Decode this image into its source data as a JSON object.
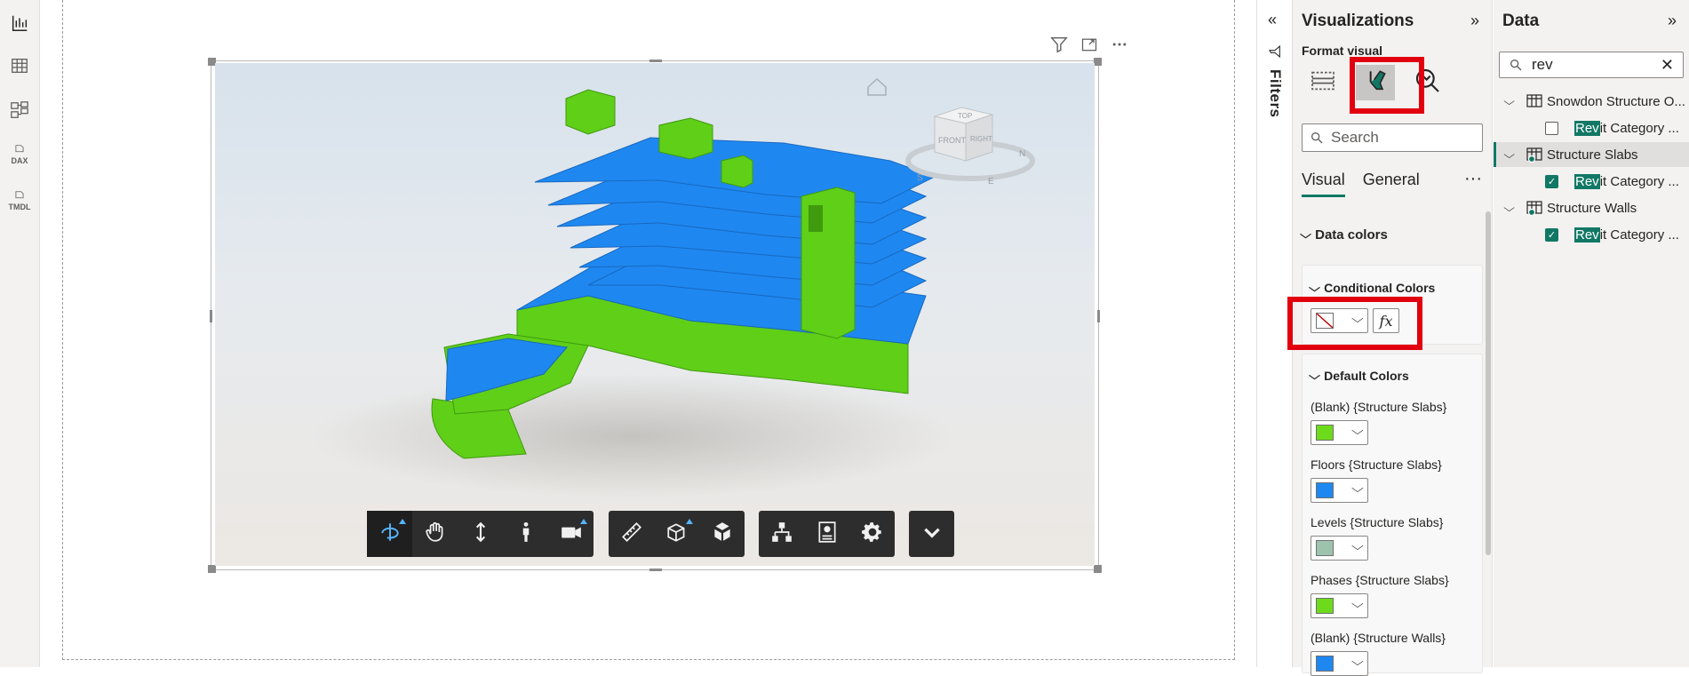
{
  "canvas": {
    "toolbar_groups": [
      [
        "orbit-icon",
        "pan-icon",
        "zoom-icon",
        "walk-icon",
        "camera-icon"
      ],
      [
        "measure-icon",
        "section-icon",
        "explode-icon"
      ],
      [
        "model-browser-icon",
        "properties-icon",
        "settings-icon"
      ],
      [
        "expand-chevron-icon"
      ]
    ]
  },
  "filters": {
    "label": "Filters"
  },
  "visualizations": {
    "title": "Visualizations",
    "format_visual_label": "Format visual",
    "search_placeholder": "Search",
    "tabs": {
      "visual": "Visual",
      "general": "General"
    },
    "sections": {
      "data_colors": "Data colors",
      "conditional_colors": "Conditional Colors",
      "default_colors": "Default Colors"
    },
    "fx_label": "fx",
    "color_rows": [
      {
        "label": "(Blank) {Structure Slabs}",
        "color": "#6ddb1c"
      },
      {
        "label": "Floors {Structure Slabs}",
        "color": "#1f88f0"
      },
      {
        "label": "Levels {Structure Slabs}",
        "color": "#9ec3ad"
      },
      {
        "label": "Phases {Structure Slabs}",
        "color": "#6ddb1c"
      },
      {
        "label": "(Blank) {Structure Walls}",
        "color": "#1f88f0"
      }
    ]
  },
  "data_pane": {
    "title": "Data",
    "search_value": "rev",
    "tree": [
      {
        "label": "Snowdon Structure O...",
        "kind": "table",
        "expanded": true
      },
      {
        "label_highlight": "Rev",
        "label_rest": "it Category ...",
        "kind": "field",
        "checked": false
      },
      {
        "label": "Structure Slabs",
        "kind": "table",
        "expanded": true,
        "selected": true
      },
      {
        "label_highlight": "Rev",
        "label_rest": "it Category ...",
        "kind": "field",
        "checked": true
      },
      {
        "label": "Structure Walls",
        "kind": "table",
        "expanded": true
      },
      {
        "label_highlight": "Rev",
        "label_rest": "it Category ...",
        "kind": "field",
        "checked": true
      }
    ]
  },
  "viewcube": {
    "top": "TOP",
    "front": "FRONT",
    "right": "RIGHT",
    "compass_s": "S",
    "compass_e": "E",
    "compass_n": "N"
  },
  "left_rail": {
    "dax": "DAX",
    "tmdl": "TMDL"
  },
  "colors": {
    "accent": "#117865",
    "highlight_box": "#e2000f",
    "slab_blue": "#1f88f0",
    "wall_green": "#6ddb1c"
  }
}
